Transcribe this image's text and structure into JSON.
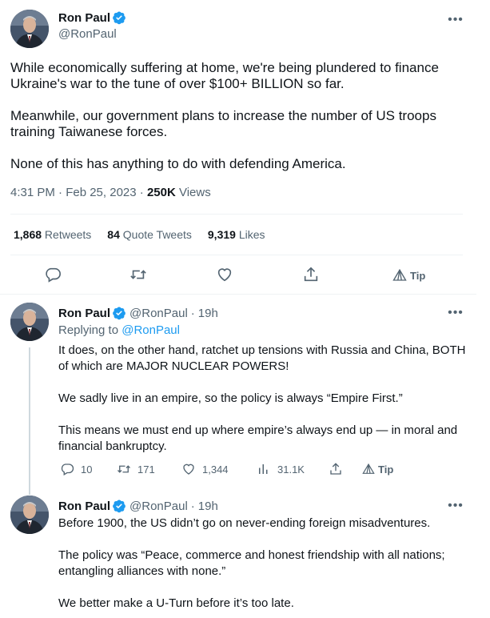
{
  "main_tweet": {
    "author": {
      "name": "Ron Paul",
      "handle": "@RonPaul"
    },
    "paragraphs": [
      "While economically suffering at home, we're being plundered to finance Ukraine's war to the tune of over $100+ BILLION so far.",
      "Meanwhile, our government plans to increase the number of US troops training Taiwanese forces.",
      "None of this has anything to do with defending America."
    ],
    "timestamp": "4:31 PM · Feb 25, 2023 · ",
    "views_count": "250K",
    "views_label": " Views",
    "stats": {
      "retweets_count": "1,868",
      "retweets_label": " Retweets",
      "quotes_count": "84",
      "quotes_label": " Quote Tweets",
      "likes_count": "9,319",
      "likes_label": " Likes"
    },
    "actions": {
      "tip_label": "Tip"
    }
  },
  "replies": [
    {
      "author": {
        "name": "Ron Paul",
        "handle": "@RonPaul"
      },
      "time": "19h",
      "replying_prefix": "Replying to ",
      "replying_to": "@RonPaul",
      "paragraphs": [
        "It does, on the other hand, ratchet up tensions with Russia and China, BOTH of which are MAJOR NUCLEAR POWERS!",
        "We sadly live in an empire, so the policy is always “Empire First.”",
        "This means we must end up where empire’s always end up — in moral and financial bankruptcy."
      ],
      "counts": {
        "replies": "10",
        "retweets": "171",
        "likes": "1,344",
        "views": "31.1K"
      },
      "tip_label": "Tip"
    },
    {
      "author": {
        "name": "Ron Paul",
        "handle": "@RonPaul"
      },
      "time": "19h",
      "paragraphs": [
        "Before 1900, the US didn’t go on never-ending foreign misadventures.",
        "The policy was “Peace, commerce and honest friendship with all nations; entangling alliances with none.”",
        "We better make a U-Turn before it’s too late."
      ]
    }
  ],
  "icons": {
    "verified": "verified-badge-icon",
    "more": "more-options-icon",
    "reply": "reply-icon",
    "retweet": "retweet-icon",
    "like": "like-icon",
    "share": "share-icon",
    "tip": "tip-icon",
    "views": "views-icon"
  },
  "colors": {
    "accent": "#1d9bf0",
    "muted": "#536471",
    "text": "#0f1419",
    "divider": "#eff3f4"
  }
}
